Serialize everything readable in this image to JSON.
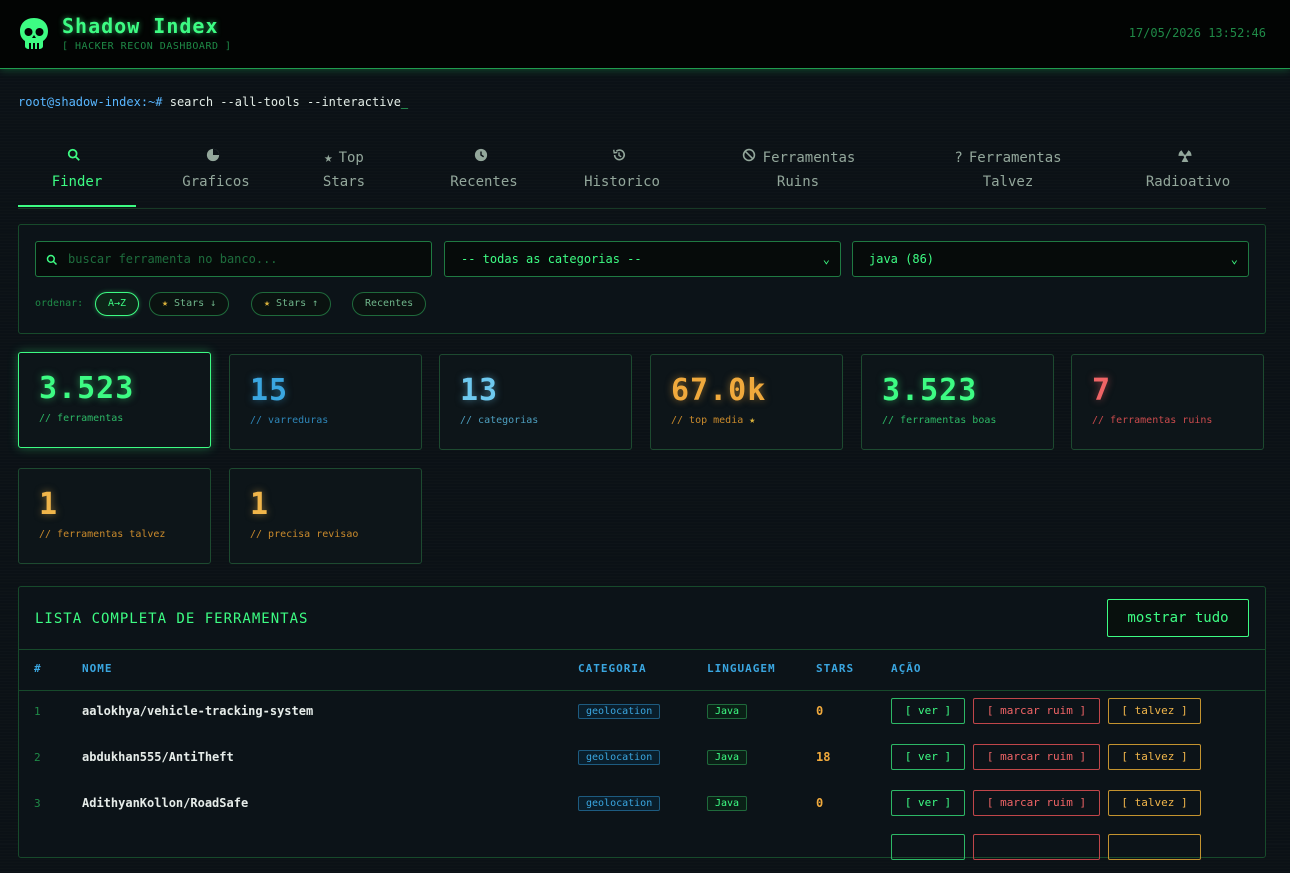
{
  "header": {
    "title": "Shadow Index",
    "subtitle": "[ HACKER RECON DASHBOARD ]",
    "clock": "17/05/2026 13:52:46",
    "accent": "#3dfc83"
  },
  "prompt": {
    "host": "root@shadow-index:~#",
    "command": "search --all-tools --interactive",
    "cursor": "_"
  },
  "tabs": [
    {
      "icon": "search-icon",
      "line1": "Finder",
      "line2": ""
    },
    {
      "icon": "pie-chart-icon",
      "line1": "Graficos",
      "line2": ""
    },
    {
      "icon": "star-icon",
      "line1": "Top",
      "line2": "Stars"
    },
    {
      "icon": "clock-icon",
      "line1": "Recentes",
      "line2": ""
    },
    {
      "icon": "history-icon",
      "line1": "Historico",
      "line2": ""
    },
    {
      "icon": "ban-icon",
      "line1": "Ferramentas",
      "line2": "Ruins"
    },
    {
      "icon": "question-icon",
      "line1": "Ferramentas",
      "line2": "Talvez"
    },
    {
      "icon": "radiation-icon",
      "line1": "Radioativo",
      "line2": ""
    }
  ],
  "filters": {
    "search_placeholder": "buscar ferramenta no banco...",
    "category_value": "-- todas as categorias --",
    "language_value": "java (86)",
    "sort_label": "ordenar:",
    "sort_options": [
      "A→Z",
      "Stars ↓",
      "Stars ↑",
      "Recentes"
    ]
  },
  "stats": [
    {
      "value": "3.523",
      "label": "// ferramentas",
      "color": "#3dfc83"
    },
    {
      "value": "15",
      "label": "// varreduras",
      "color": "#3aa6e0"
    },
    {
      "value": "13",
      "label": "// categorias",
      "color": "#6ec9ef"
    },
    {
      "value": "67.0k",
      "label": "// top media",
      "color": "#f0a93c"
    },
    {
      "value": "3.523",
      "label": "// ferramentas boas",
      "color": "#3dfc83"
    },
    {
      "value": "7",
      "label": "// ferramentas ruins",
      "color": "#f06466"
    },
    {
      "value": "1",
      "label": "// ferramentas talvez",
      "color": "#f0b54a"
    },
    {
      "value": "1",
      "label": "// precisa revisao",
      "color": "#f0b54a"
    }
  ],
  "list": {
    "title": "LISTA COMPLETA DE FERRAMENTAS",
    "show_all": "mostrar tudo",
    "columns": [
      "#",
      "NOME",
      "CATEGORIA",
      "LINGUAGEM",
      "STARS",
      "AÇÃO"
    ],
    "actions": {
      "ver": "[ ver ]",
      "ruim": "[ marcar ruim ]",
      "talvez": "[ talvez ]"
    },
    "rows": [
      {
        "idx": "1",
        "name": "aalokhya/vehicle-tracking-system",
        "category": "geolocation",
        "language": "Java",
        "stars": "0"
      },
      {
        "idx": "2",
        "name": "abdukhan555/AntiTheft",
        "category": "geolocation",
        "language": "Java",
        "stars": "18"
      },
      {
        "idx": "3",
        "name": "AdithyanKollon/RoadSafe",
        "category": "geolocation",
        "language": "Java",
        "stars": "0"
      }
    ]
  }
}
